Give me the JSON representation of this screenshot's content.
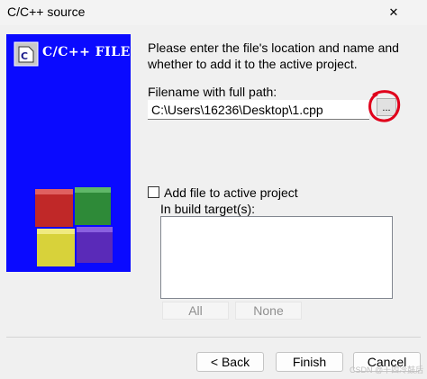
{
  "window": {
    "title": "C/C++ source",
    "close_glyph": "✕"
  },
  "side_panel": {
    "banner_text": "C/C++ FILE",
    "logo_icon": "file-document-icon",
    "decor_icon": "colored-cubes-icon",
    "colors": {
      "background": "#0a0aff",
      "red": "#c02828",
      "green": "#2e8a38",
      "yellow": "#d8d23a",
      "purple": "#5a2ab8"
    }
  },
  "form": {
    "instruction_line1": "Please enter the file's location and name and",
    "instruction_line2": "whether to add it to the active project.",
    "path_label": "Filename with full path:",
    "path_value": "C:\\Users\\16236\\Desktop\\1.cpp",
    "browse_label": "...",
    "browse_highlight_color": "#e0001b",
    "add_to_project_label": "Add file to active project",
    "add_to_project_checked": false,
    "build_targets_label": "In build target(s):",
    "build_targets": [],
    "all_label": "All",
    "none_label": "None"
  },
  "footer": {
    "back_label": "< Back",
    "finish_label": "Finish",
    "cancel_label": "Cancel",
    "watermark": "CSDN @十四冷鼓后"
  }
}
